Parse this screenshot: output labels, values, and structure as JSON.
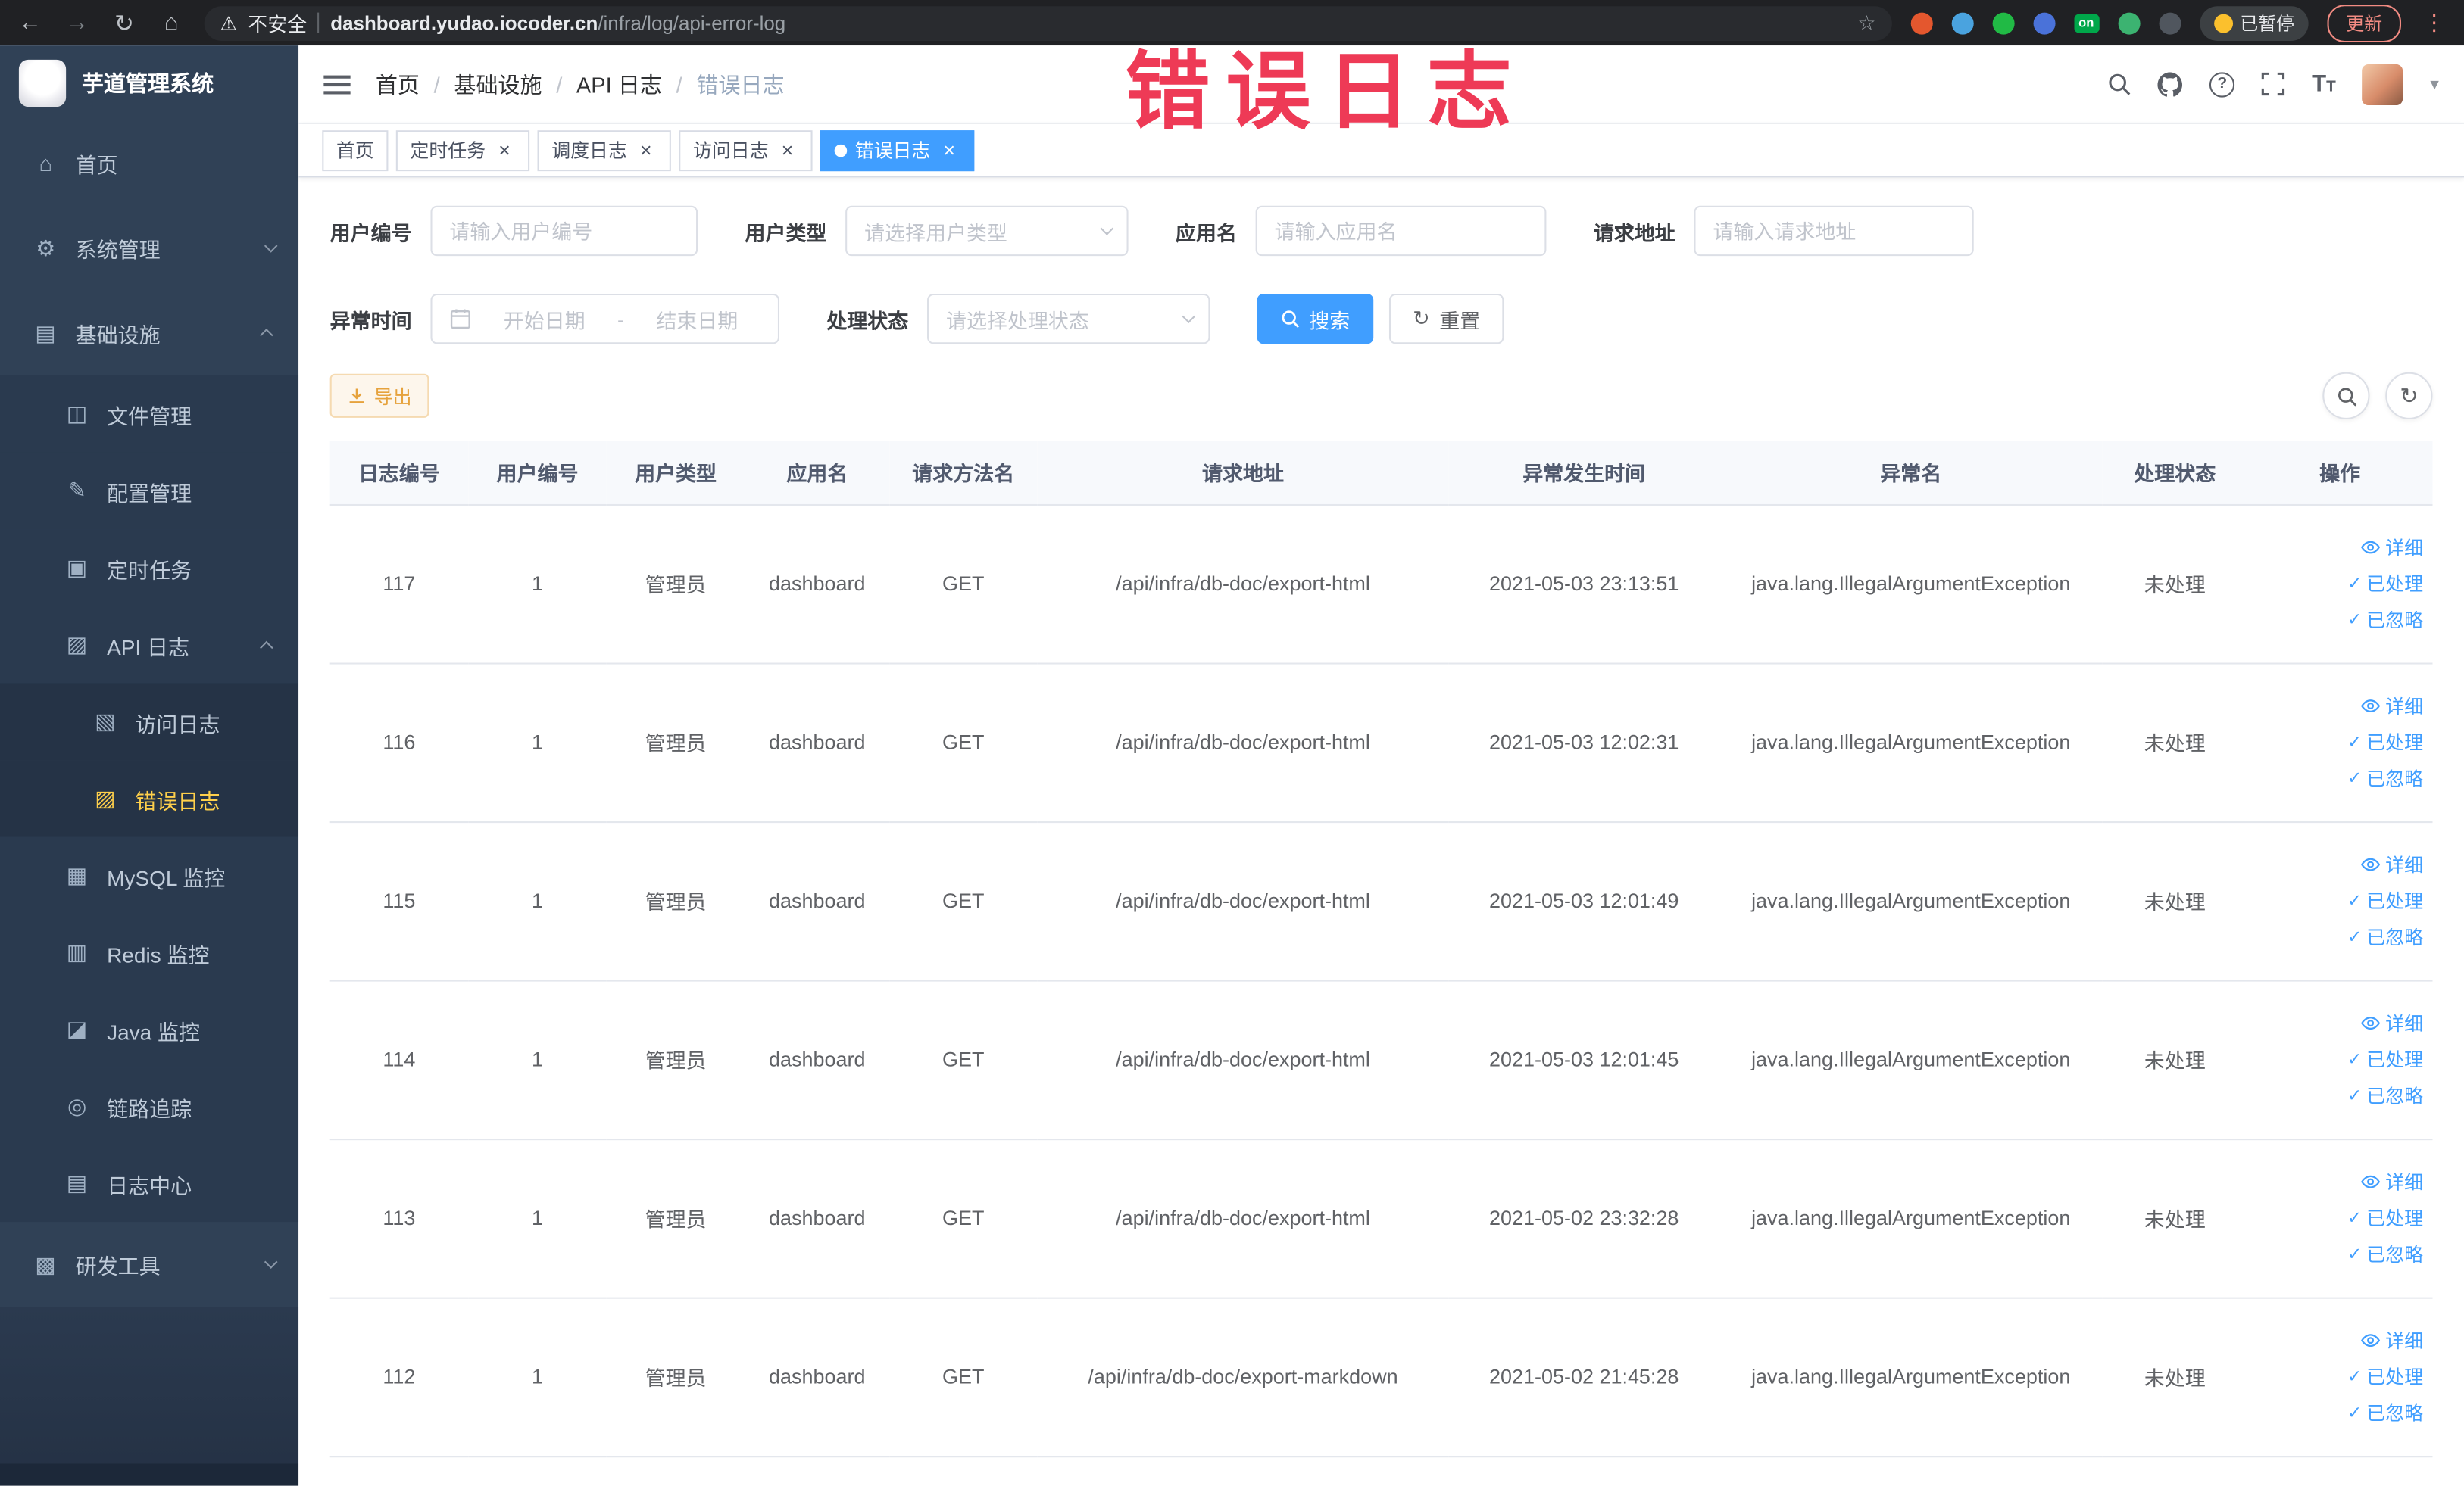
{
  "browser": {
    "back_icon": "←",
    "forward_icon": "→",
    "reload_icon": "↻",
    "home_icon": "⌂",
    "security_label": "不安全",
    "url_host": "dashboard.yudao.iocoder.cn",
    "url_path": "/infra/log/api-error-log",
    "extension_badge": "on",
    "paused_badge": "已暂停",
    "update_label": "更新"
  },
  "annotation": {
    "text": "错误日志",
    "color": "#ee3a56"
  },
  "sidebar": {
    "logo_title": "芋道管理系统",
    "menu": [
      {
        "key": "home",
        "label": "首页",
        "icon": "home-icon",
        "glyph": "⌂",
        "level": 0
      },
      {
        "key": "system-mgmt",
        "label": "系统管理",
        "icon": "gear-icon",
        "glyph": "⚙",
        "level": 0,
        "arrow": "down"
      },
      {
        "key": "infrastructure",
        "label": "基础设施",
        "icon": "infra-icon",
        "glyph": "▤",
        "level": 0,
        "arrow": "up"
      },
      {
        "key": "file-mgmt",
        "label": "文件管理",
        "icon": "file-icon",
        "glyph": "◫",
        "level": 1
      },
      {
        "key": "config-mgmt",
        "label": "配置管理",
        "icon": "pencil-icon",
        "glyph": "✎",
        "level": 1
      },
      {
        "key": "cron-job",
        "label": "定时任务",
        "icon": "schedule-icon",
        "glyph": "▣",
        "level": 1
      },
      {
        "key": "api-log",
        "label": "API 日志",
        "icon": "api-log-icon",
        "glyph": "▨",
        "level": 1,
        "arrow": "up"
      },
      {
        "key": "access-log",
        "label": "访问日志",
        "icon": "access-log-icon",
        "glyph": "▧",
        "level": 2
      },
      {
        "key": "error-log",
        "label": "错误日志",
        "icon": "error-log-icon",
        "glyph": "▨",
        "level": 2,
        "active": true
      },
      {
        "key": "mysql-monitor",
        "label": "MySQL 监控",
        "icon": "mysql-icon",
        "glyph": "▦",
        "level": 1
      },
      {
        "key": "redis-monitor",
        "label": "Redis 监控",
        "icon": "redis-icon",
        "glyph": "▥",
        "level": 1
      },
      {
        "key": "java-monitor",
        "label": "Java 监控",
        "icon": "java-icon",
        "glyph": "◪",
        "level": 1
      },
      {
        "key": "trace",
        "label": "链路追踪",
        "icon": "trace-icon",
        "glyph": "◎",
        "level": 1
      },
      {
        "key": "log-center",
        "label": "日志中心",
        "icon": "log-center-icon",
        "glyph": "▤",
        "level": 1
      },
      {
        "key": "dev-tools",
        "label": "研发工具",
        "icon": "toolbox-icon",
        "glyph": "▩",
        "level": 0,
        "arrow": "down"
      }
    ]
  },
  "breadcrumb": [
    "首页",
    "基础设施",
    "API 日志",
    "错误日志"
  ],
  "tabs": [
    {
      "label": "首页",
      "closable": false,
      "active": false
    },
    {
      "label": "定时任务",
      "closable": true,
      "active": false
    },
    {
      "label": "调度日志",
      "closable": true,
      "active": false
    },
    {
      "label": "访问日志",
      "closable": true,
      "active": false
    },
    {
      "label": "错误日志",
      "closable": true,
      "active": true
    }
  ],
  "filters": {
    "user_id": {
      "label": "用户编号",
      "placeholder": "请输入用户编号",
      "value": ""
    },
    "user_type": {
      "label": "用户类型",
      "placeholder": "请选择用户类型",
      "value": ""
    },
    "app_name": {
      "label": "应用名",
      "placeholder": "请输入应用名",
      "value": ""
    },
    "request_url": {
      "label": "请求地址",
      "placeholder": "请输入请求地址",
      "value": ""
    },
    "exception_time": {
      "label": "异常时间",
      "start_placeholder": "开始日期",
      "separator": "-",
      "end_placeholder": "结束日期"
    },
    "process_status": {
      "label": "处理状态",
      "placeholder": "请选择处理状态",
      "value": ""
    },
    "search_label": "搜索",
    "reset_label": "重置"
  },
  "toolbar": {
    "export_label": "导出"
  },
  "table": {
    "columns": [
      "日志编号",
      "用户编号",
      "用户类型",
      "应用名",
      "请求方法名",
      "请求地址",
      "异常发生时间",
      "异常名",
      "处理状态",
      "操作"
    ],
    "actions": [
      "详细",
      "已处理",
      "已忽略"
    ],
    "rows": [
      {
        "id": "117",
        "user_id": "1",
        "user_type": "管理员",
        "app": "dashboard",
        "method": "GET",
        "url": "/api/infra/db-doc/export-html",
        "time": "2021-05-03 23:13:51",
        "exception": "java.lang.IllegalArgumentException",
        "status": "未处理"
      },
      {
        "id": "116",
        "user_id": "1",
        "user_type": "管理员",
        "app": "dashboard",
        "method": "GET",
        "url": "/api/infra/db-doc/export-html",
        "time": "2021-05-03 12:02:31",
        "exception": "java.lang.IllegalArgumentException",
        "status": "未处理"
      },
      {
        "id": "115",
        "user_id": "1",
        "user_type": "管理员",
        "app": "dashboard",
        "method": "GET",
        "url": "/api/infra/db-doc/export-html",
        "time": "2021-05-03 12:01:49",
        "exception": "java.lang.IllegalArgumentException",
        "status": "未处理"
      },
      {
        "id": "114",
        "user_id": "1",
        "user_type": "管理员",
        "app": "dashboard",
        "method": "GET",
        "url": "/api/infra/db-doc/export-html",
        "time": "2021-05-03 12:01:45",
        "exception": "java.lang.IllegalArgumentException",
        "status": "未处理"
      },
      {
        "id": "113",
        "user_id": "1",
        "user_type": "管理员",
        "app": "dashboard",
        "method": "GET",
        "url": "/api/infra/db-doc/export-html",
        "time": "2021-05-02 23:32:28",
        "exception": "java.lang.IllegalArgumentException",
        "status": "未处理"
      },
      {
        "id": "112",
        "user_id": "1",
        "user_type": "管理员",
        "app": "dashboard",
        "method": "GET",
        "url": "/api/infra/db-doc/export-markdown",
        "time": "2021-05-02 21:45:28",
        "exception": "java.lang.IllegalArgumentException",
        "status": "未处理"
      }
    ]
  },
  "colors": {
    "accent": "#409eff",
    "sidebar_bg": "#304156",
    "sidebar_active": "#ffd04b",
    "warning": "#e6a23c",
    "annotation": "#ee3a56"
  }
}
